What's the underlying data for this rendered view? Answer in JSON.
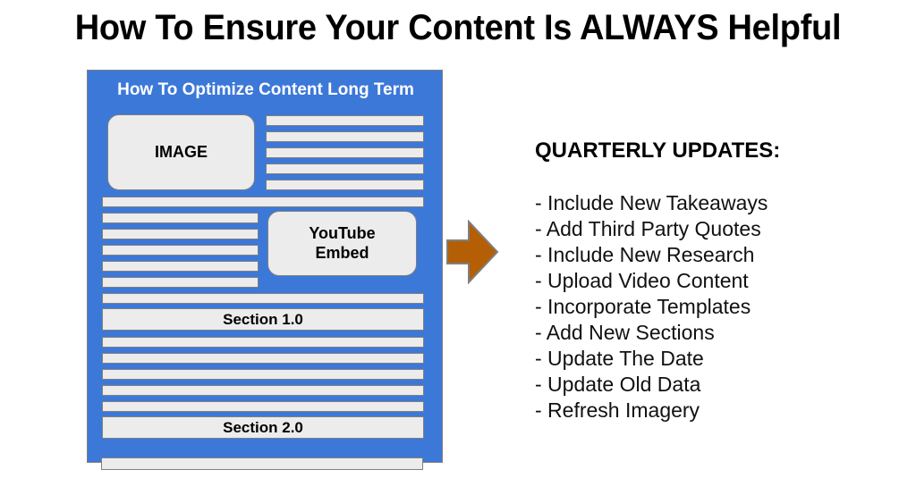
{
  "page": {
    "title": "How To Ensure Your Content Is ALWAYS Helpful",
    "background_color": "#ffffff"
  },
  "colors": {
    "panel_blue": "#3c78d8",
    "bar_gray": "#ececec",
    "bar_border": "#7f7f7f",
    "arrow_orange": "#b45f06",
    "arrow_border": "#7f7f7f",
    "text_black": "#000000",
    "panel_title_white": "#ffffff"
  },
  "doc_panel": {
    "title": "How To Optimize Content Long Term",
    "image_box_label": "IMAGE",
    "video_box_label": "YouTube\nEmbed",
    "video_box_line1": "YouTube",
    "video_box_line2": "Embed",
    "section_1_label": "Section 1.0",
    "section_2_label": "Section 2.0",
    "top_right_bar_count": 5,
    "mid_left_bar_count": 5,
    "between_sections_bar_count": 5,
    "full_width_bar_count": 3
  },
  "arrow": {
    "direction": "right",
    "icon": "right-arrow-icon"
  },
  "updates": {
    "heading": "QUARTERLY UPDATES:",
    "items": [
      "- Include New Takeaways",
      "- Add Third Party Quotes",
      "- Include New Research",
      "- Upload Video Content",
      "- Incorporate Templates",
      "- Add New Sections",
      "- Update The Date",
      "- Update Old Data",
      "- Refresh Imagery"
    ]
  }
}
